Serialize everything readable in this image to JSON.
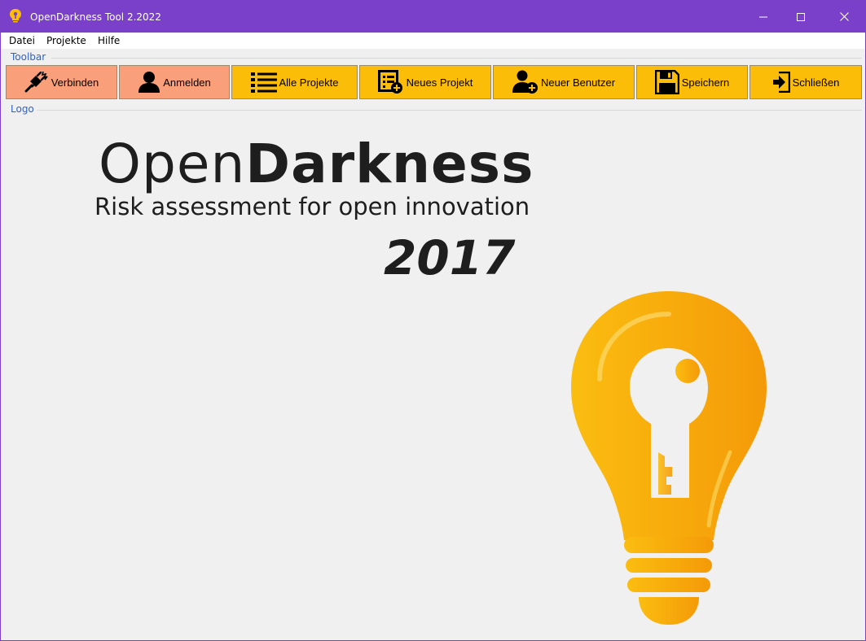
{
  "window": {
    "title": "OpenDarkness Tool 2.2022"
  },
  "menu": {
    "items": [
      "Datei",
      "Projekte",
      "Hilfe"
    ]
  },
  "groups": {
    "toolbar_label": "Toolbar",
    "logo_label": "Logo"
  },
  "toolbar": {
    "buttons": [
      {
        "label": "Verbinden",
        "icon": "plug-icon",
        "color": "#f9a07a"
      },
      {
        "label": "Anmelden",
        "icon": "user-icon",
        "color": "#f9a07a"
      },
      {
        "label": "Alle Projekte",
        "icon": "list-icon",
        "color": "#fbbd08"
      },
      {
        "label": "Neues Projekt",
        "icon": "new-project-icon",
        "color": "#fbbd08"
      },
      {
        "label": "Neuer Benutzer",
        "icon": "add-user-icon",
        "color": "#fbbd08"
      },
      {
        "label": "Speichern",
        "icon": "save-icon",
        "color": "#fbbd08"
      },
      {
        "label": "Schließen",
        "icon": "exit-icon",
        "color": "#fbbd08"
      }
    ]
  },
  "logo": {
    "brand_light": "Open",
    "brand_bold": "Darkness",
    "tagline": "Risk assessment for open innovation",
    "year": "2017"
  },
  "colors": {
    "titlebar": "#7a40c9",
    "accent_salmon": "#f9a07a",
    "accent_yellow": "#fbbd08",
    "bulb_orange": "#f7a90c"
  }
}
